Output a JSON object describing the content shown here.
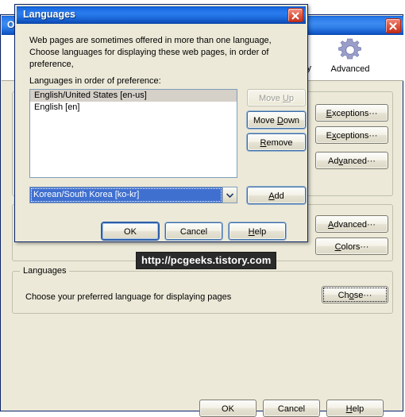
{
  "background_window": {
    "title": "O",
    "close_icon": "close-icon",
    "tabs": [
      {
        "label": "y",
        "icon": "partial-tab-icon",
        "selected": false
      },
      {
        "label": "Advanced",
        "icon": "gear-icon",
        "selected": true
      }
    ],
    "groups": [
      {
        "title": "",
        "buttons": [
          {
            "label": "Exceptions",
            "suffix": "···",
            "accel": "E"
          },
          {
            "label": "Exceptions",
            "suffix": "···",
            "accel": "x"
          },
          {
            "label": "Advanced",
            "suffix": "···",
            "accel": "v"
          }
        ]
      },
      {
        "title": "",
        "buttons": [
          {
            "label": "Advanced",
            "suffix": "···",
            "accel": "A"
          },
          {
            "label": "Colors",
            "suffix": "···",
            "accel": "C"
          }
        ]
      }
    ],
    "languages_group": {
      "title": "Languages",
      "description": "Choose your preferred language for displaying pages",
      "choose_button": {
        "label": "Choose",
        "suffix": "···",
        "accel": "o"
      }
    },
    "footer_buttons": [
      {
        "label": "OK"
      },
      {
        "label": "Cancel"
      },
      {
        "label": "Help",
        "accel": "H"
      }
    ]
  },
  "watermark": {
    "text": "http://pcgeeks.tistory.com"
  },
  "dialog": {
    "title": "Languages",
    "close_icon": "close-icon",
    "description": "Web pages are sometimes offered in more than one language, Choose languages for displaying these web pages, in order of preference,",
    "list_label": "Languages in order of preference:",
    "language_list": [
      {
        "label": "English/United States  [en-us]",
        "selected": true
      },
      {
        "label": "English  [en]",
        "selected": false
      }
    ],
    "list_buttons": [
      {
        "label": "Move Up",
        "accel": "U",
        "enabled": false
      },
      {
        "label": "Move Down",
        "accel": "D",
        "enabled": true
      },
      {
        "label": "Remove",
        "accel": "R",
        "enabled": true
      }
    ],
    "combo": {
      "selected_value": "Korean/South Korea  [ko-kr]",
      "arrow_icon": "chevron-down-icon"
    },
    "add_button": {
      "label": "Add",
      "accel": "A"
    },
    "footer_buttons": [
      {
        "label": "OK",
        "default": true
      },
      {
        "label": "Cancel"
      },
      {
        "label": "Help",
        "accel": "H"
      }
    ]
  },
  "colors": {
    "dialog_face": "#ece9d8",
    "titlebar_blue": "#1a6ae0",
    "selection_blue": "#3f6fcf",
    "list_selection_gray": "#d5d0c8",
    "close_red": "#c33420",
    "window_border": "#0a246a"
  }
}
